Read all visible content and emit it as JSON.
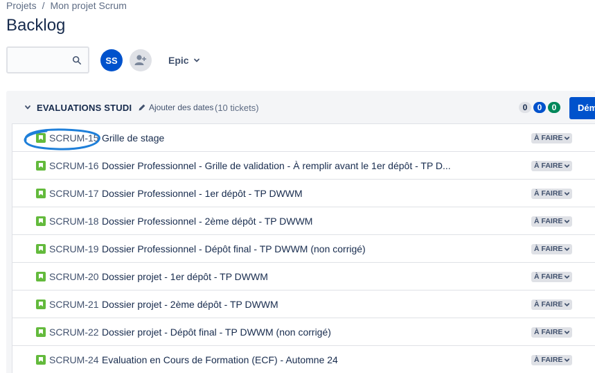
{
  "breadcrumb": {
    "items": [
      "Projets",
      "Mon projet Scrum"
    ],
    "separator": "/"
  },
  "page": {
    "title": "Backlog"
  },
  "toolbar": {
    "search_placeholder": "",
    "avatar_initials": "SS",
    "epic_label": "Epic"
  },
  "sprint": {
    "name": "EVALUATIONS STUDI",
    "add_dates_label": "Ajouter des dates",
    "ticket_count": "(10 tickets)",
    "counts": {
      "todo": "0",
      "in_progress": "0",
      "done": "0"
    },
    "start_button": "Dém"
  },
  "issues": [
    {
      "key": "SCRUM-15",
      "summary": "Grille de stage",
      "status": "À FAIRE"
    },
    {
      "key": "SCRUM-16",
      "summary": "Dossier Professionnel - Grille de validation - À remplir avant le 1er dépôt - TP D...",
      "status": "À FAIRE"
    },
    {
      "key": "SCRUM-17",
      "summary": "Dossier Professionnel - 1er dépôt - TP DWWM",
      "status": "À FAIRE"
    },
    {
      "key": "SCRUM-18",
      "summary": "Dossier Professionnel - 2ème dépôt - TP DWWM",
      "status": "À FAIRE"
    },
    {
      "key": "SCRUM-19",
      "summary": "Dossier Professionnel - Dépôt final - TP DWWM (non corrigé)",
      "status": "À FAIRE"
    },
    {
      "key": "SCRUM-20",
      "summary": "Dossier projet - 1er dépôt - TP DWWM",
      "status": "À FAIRE"
    },
    {
      "key": "SCRUM-21",
      "summary": "Dossier projet - 2ème dépôt - TP DWWM",
      "status": "À FAIRE"
    },
    {
      "key": "SCRUM-22",
      "summary": "Dossier projet - Dépôt final - TP DWWM (non corrigé)",
      "status": "À FAIRE"
    },
    {
      "key": "SCRUM-24",
      "summary": "Evaluation en Cours de Formation (ECF) - Automne 24",
      "status": "À FAIRE"
    }
  ],
  "icons": {
    "search": "search-icon",
    "add_user": "add-user-icon",
    "chevron": "chevron-down-icon",
    "pencil": "pencil-icon",
    "story": "story-icon"
  },
  "colors": {
    "accent": "#0052cc",
    "story": "#63ba3c",
    "done": "#00875a",
    "highlight": "#1e7fd9"
  }
}
